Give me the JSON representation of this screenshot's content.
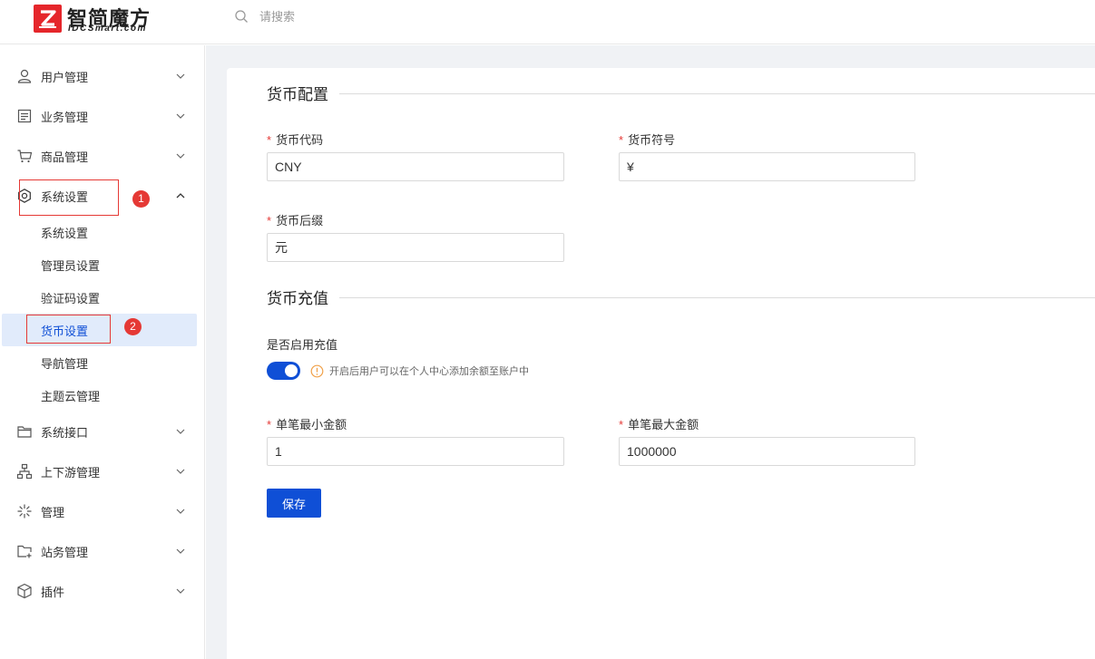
{
  "header": {
    "logo_name": "智简魔方",
    "logo_sub": "IDCSmart.com",
    "search_placeholder": "请搜索"
  },
  "sidebar": {
    "items": [
      {
        "label": "用户管理",
        "icon": "user-icon"
      },
      {
        "label": "业务管理",
        "icon": "document-icon"
      },
      {
        "label": "商品管理",
        "icon": "cart-icon"
      },
      {
        "label": "系统设置",
        "icon": "settings-icon",
        "expanded": true
      },
      {
        "label": "系统接口",
        "icon": "folder-icon"
      },
      {
        "label": "上下游管理",
        "icon": "hierarchy-icon"
      },
      {
        "label": "管理",
        "icon": "sparkle-icon"
      },
      {
        "label": "站务管理",
        "icon": "folder-add-icon"
      },
      {
        "label": "插件",
        "icon": "cube-icon"
      }
    ],
    "sub_items": [
      {
        "label": "系统设置"
      },
      {
        "label": "管理员设置"
      },
      {
        "label": "验证码设置"
      },
      {
        "label": "货币设置",
        "active": true
      },
      {
        "label": "导航管理"
      },
      {
        "label": "主题云管理"
      }
    ],
    "badges": [
      "1",
      "2"
    ]
  },
  "form": {
    "section_currency": "货币配置",
    "currency_code": {
      "label": "货币代码",
      "value": "CNY"
    },
    "currency_symbol": {
      "label": "货币符号",
      "value": "¥"
    },
    "currency_suffix": {
      "label": "货币后缀",
      "value": "元"
    },
    "section_recharge": "货币充值",
    "recharge_enable": {
      "label": "是否启用充值",
      "enabled": true,
      "tip": "开启后用户可以在个人中心添加余额至账户中"
    },
    "min_amount": {
      "label": "单笔最小金额",
      "value": "1"
    },
    "max_amount": {
      "label": "单笔最大金额",
      "value": "1000000"
    },
    "required_mark": "*",
    "save_label": "保存"
  },
  "colors": {
    "primary": "#0f4fd6",
    "active_bg": "#e1ebfb",
    "required": "#e53935",
    "logo": "#e5262b",
    "warning": "#f0a14a"
  }
}
